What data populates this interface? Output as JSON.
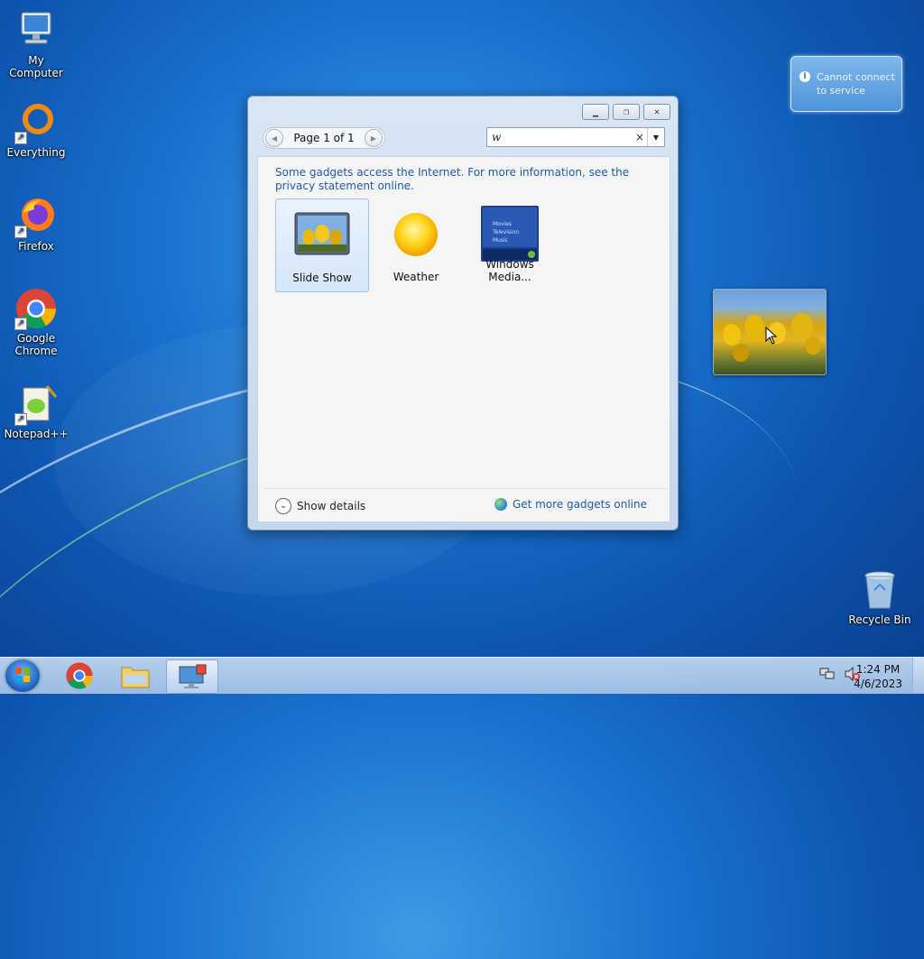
{
  "desktop": {
    "icons": [
      {
        "label": "My Computer"
      },
      {
        "label": "Everything"
      },
      {
        "label": "Firefox"
      },
      {
        "label": "Google Chrome"
      },
      {
        "label": "Notepad++"
      },
      {
        "label": "Recycle Bin"
      }
    ]
  },
  "notification": {
    "text": "Cannot connect to service",
    "icon": "info-icon"
  },
  "gadget_window": {
    "nav": {
      "page_label": "Page 1 of 1"
    },
    "search": {
      "value": "w",
      "clear": "×"
    },
    "info_text": "Some gadgets access the Internet.  For more information, see the privacy statement online.",
    "gadgets": [
      {
        "label": "Slide Show",
        "selected": true
      },
      {
        "label": "Weather",
        "selected": false
      },
      {
        "label": "Windows Media...",
        "selected": false
      }
    ],
    "wmc_thumb_lines": [
      "Movies",
      "Television",
      "Music"
    ],
    "footer": {
      "details_label": "Show details",
      "online_link": "Get more gadgets online"
    }
  },
  "taskbar": {
    "items": [
      "start-button",
      "chrome",
      "explorer",
      "desktop-gadget-gallery"
    ],
    "clock": {
      "time": "1:24 PM",
      "date": "4/6/2023"
    }
  }
}
